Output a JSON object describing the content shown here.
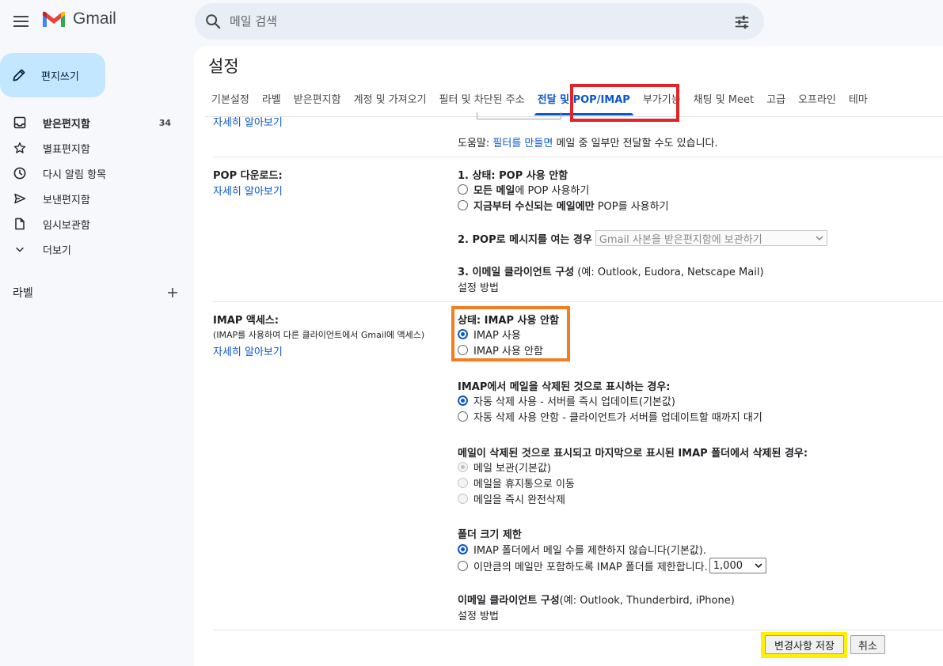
{
  "app": {
    "logo_text": "Gmail"
  },
  "search": {
    "placeholder": "메일 검색"
  },
  "sidebar": {
    "compose_label": "편지쓰기",
    "items": [
      {
        "label": "받은편지함",
        "count": "34",
        "icon": "inbox-icon"
      },
      {
        "label": "별표편지함",
        "icon": "star-icon"
      },
      {
        "label": "다시 알림 항목",
        "icon": "clock-icon"
      },
      {
        "label": "보낸편지함",
        "icon": "send-icon"
      },
      {
        "label": "임시보관함",
        "icon": "draft-icon"
      },
      {
        "label": "더보기",
        "icon": "chevron-down-icon"
      }
    ],
    "labels_heading": "라벨"
  },
  "settings": {
    "title": "설정",
    "tabs": [
      "기본설정",
      "라벨",
      "받은편지함",
      "계정 및 가져오기",
      "필터 및 차단된 주소",
      "전달 및 POP/IMAP",
      "부가기능",
      "채팅 및 Meet",
      "고급",
      "오프라인",
      "테마"
    ],
    "active_tab": "전달 및 POP/IMAP",
    "learn_more": "자세히 알아보기",
    "forward_help": {
      "prefix": "도움말: ",
      "link": "필터를 만들면",
      "suffix": " 메일 중 일부만 전달할 수도 있습니다."
    },
    "pop": {
      "label": "POP 다운로드:",
      "status_num": "1. 상태: POP 사용 안함",
      "opt1_bold": "모든 메일",
      "opt1_rest": "에 POP 사용하기",
      "opt2_bold": "지금부터 수신되는 메일에만",
      "opt2_rest": " POP를 사용하기",
      "open_label": "2. POP로 메시지를 여는 경우",
      "open_select": "Gmail 사본을 받은편지함에 보관하기",
      "client_bold": "3. 이메일 클라이언트 구성",
      "client_rest": " (예: Outlook, Eudora, Netscape Mail)",
      "setup_link": "설정 방법"
    },
    "imap": {
      "label": "IMAP 액세스:",
      "desc": "(IMAP를 사용하여 다른 클라이언트에서 Gmail에 액세스)",
      "status": "상태: IMAP 사용 안함",
      "enable": "IMAP 사용",
      "disable": "IMAP 사용 안함",
      "deleted_heading": "IMAP에서 메일을 삭제된 것으로 표시하는 경우:",
      "deleted_opt1": "자동 삭제 사용 - 서버를 즉시 업데이트(기본값)",
      "deleted_opt2": "자동 삭제 사용 안함 - 클라이언트가 서버를 업데이트할 때까지 대기",
      "expunge_heading": "메일이 삭제된 것으로 표시되고 마지막으로 표시된 IMAP 폴더에서 삭제된 경우:",
      "expunge_opt1": "메일 보관(기본값)",
      "expunge_opt2": "메일을 휴지통으로 이동",
      "expunge_opt3": "메일을 즉시 완전삭제",
      "folder_heading": "폴더 크기 제한",
      "folder_opt1": "IMAP 폴더에서 메일 수를 제한하지 않습니다(기본값).",
      "folder_opt2": "이만큼의 메일만 포함하도록 IMAP 폴더를 제한합니다.",
      "folder_limit": "1,000",
      "client_bold": "이메일 클라이언트 구성",
      "client_rest": "(예: Outlook, Thunderbird, iPhone)",
      "setup_link": "설정 방법"
    },
    "save_button": "변경사항 저장",
    "cancel_button": "취소"
  },
  "colors": {
    "accent": "#0b57d0",
    "compose_bg": "#c2e7ff",
    "highlight_red": "#e0242b",
    "highlight_orange": "#f37e22",
    "highlight_yellow": "#ffef00"
  }
}
